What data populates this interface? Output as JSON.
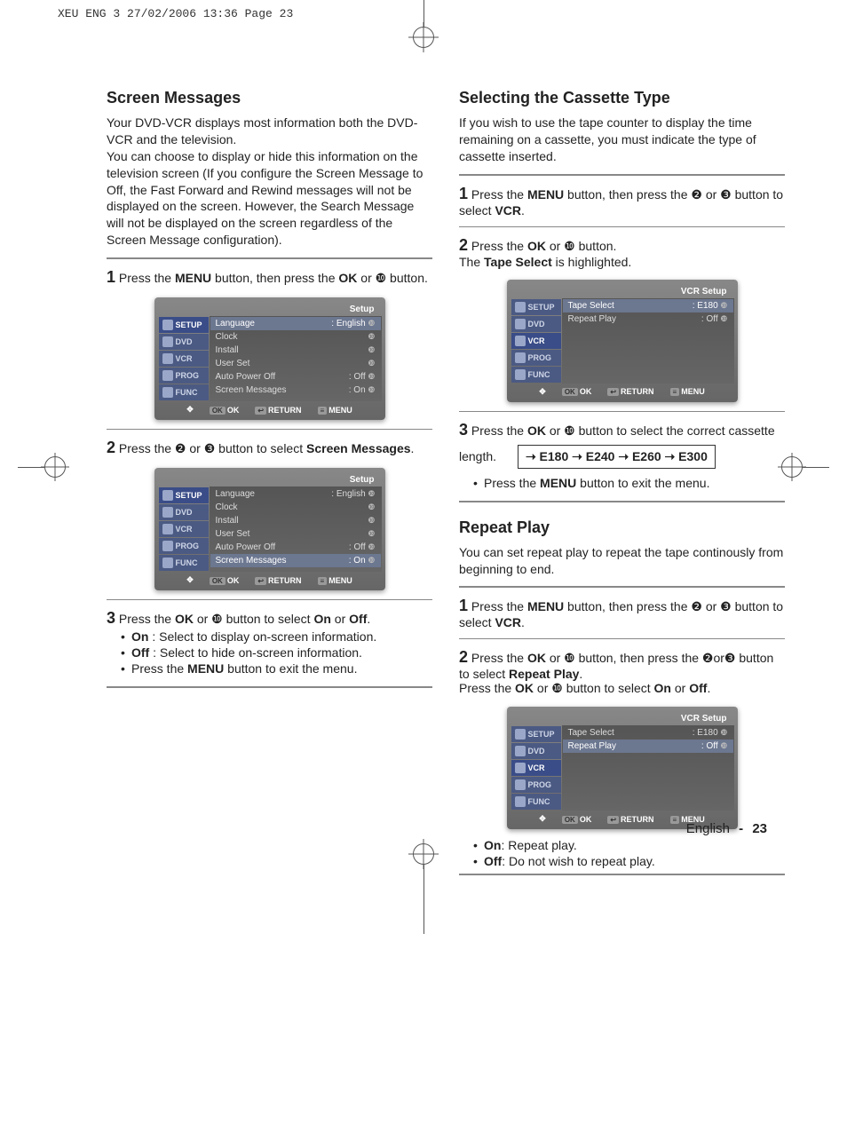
{
  "print_header": "XEU ENG 3   27/02/2006  13:36  Page 23",
  "left": {
    "title": "Screen Messages",
    "intro": "Your DVD-VCR displays most information both the DVD-VCR and the television.\nYou can choose to display or hide this information on the television screen (If you configure the Screen Message to Off, the Fast Forward and Rewind messages will not be displayed on the screen. However, the Search Message will not be displayed on the screen regardless of the Screen Message configuration).",
    "step1": {
      "num": "1",
      "text_a": "Press the ",
      "bold_a": "MENU",
      "text_b": " button, then press the ",
      "bold_b": "OK",
      "text_c": " or ❿ button."
    },
    "step2": {
      "num": "2",
      "text_a": "Press the ❷ or ❸ button to select ",
      "bold_a": "Screen Messages",
      "text_b": "."
    },
    "step3": {
      "num": "3",
      "text_a": "Press the ",
      "bold_a": "OK",
      "text_b": " or ❿ button to select ",
      "bold_b": "On",
      "text_c": " or ",
      "bold_c": "Off",
      "text_d": "."
    },
    "bullets": [
      {
        "b": "On",
        "t": " : Select to display on-screen information."
      },
      {
        "b": "Off",
        "t": " : Select to hide on-screen information."
      },
      {
        "b": "",
        "t": "Press the ",
        "b2": "MENU",
        "t2": " button to exit the menu."
      }
    ]
  },
  "right": {
    "sec1": {
      "title": "Selecting the Cassette Type",
      "intro": "If you wish to use the tape counter to display the time remaining on a cassette, you must indicate the type of cassette inserted.",
      "step1": {
        "num": "1",
        "text_a": "Press the ",
        "bold_a": "MENU",
        "text_b": " button, then press the ❷ or ❸ button to select ",
        "bold_b": "VCR",
        "text_c": "."
      },
      "step2": {
        "num": "2",
        "text_a": "Press the ",
        "bold_a": "OK",
        "text_b": " or ❿ button.",
        "line2_a": "The ",
        "line2_b": "Tape Select",
        "line2_c": " is highlighted."
      },
      "step3": {
        "num": "3",
        "text_a": "Press the ",
        "bold_a": "OK",
        "text_b": " or ❿ button to select the correct cassette length."
      },
      "chain": "➝ E180 ➝ E240 ➝ E260 ➝ E300",
      "bullet": {
        "t": "Press the ",
        "b": "MENU",
        "t2": " button to exit the menu."
      }
    },
    "sec2": {
      "title": "Repeat Play",
      "intro": "You can set repeat play to repeat the tape continously from beginning to end.",
      "step1": {
        "num": "1",
        "text_a": "Press the ",
        "bold_a": "MENU",
        "text_b": " button, then press the ❷ or ❸ button to select ",
        "bold_b": "VCR",
        "text_c": "."
      },
      "step2": {
        "num": "2",
        "text_a": "Press the ",
        "bold_a": "OK",
        "text_b": " or ❿ button, then press the ❷or❸ button to select ",
        "bold_b": "Repeat Play",
        "text_c": ".",
        "line2_a": "Press the ",
        "line2_b": "OK",
        "line2_c": " or ❿ button to select ",
        "line2_d": "On",
        "line2_e": " or ",
        "line2_f": "Off",
        "line2_g": "."
      },
      "bullets": [
        {
          "b": "On",
          "t": ": Repeat play."
        },
        {
          "b": "Off",
          "t": ": Do not wish to repeat play."
        }
      ]
    }
  },
  "osd_setup": {
    "title": "Setup",
    "tabs": [
      "SETUP",
      "DVD",
      "VCR",
      "PROG",
      "FUNC"
    ],
    "rows": [
      {
        "label": "Language",
        "value": ": English"
      },
      {
        "label": "Clock",
        "value": ""
      },
      {
        "label": "Install",
        "value": ""
      },
      {
        "label": "User Set",
        "value": ""
      },
      {
        "label": "Auto Power Off",
        "value": ": Off"
      },
      {
        "label": "Screen Messages",
        "value": ": On"
      }
    ],
    "footer": {
      "ok": "OK",
      "ret": "RETURN",
      "menu": "MENU"
    }
  },
  "osd_setup_hl": {
    "title": "Setup",
    "tabs": [
      "SETUP",
      "DVD",
      "VCR",
      "PROG",
      "FUNC"
    ],
    "rows": [
      {
        "label": "Language",
        "value": ": English"
      },
      {
        "label": "Clock",
        "value": ""
      },
      {
        "label": "Install",
        "value": ""
      },
      {
        "label": "User Set",
        "value": ""
      },
      {
        "label": "Auto Power Off",
        "value": ": Off"
      },
      {
        "label": "Screen Messages",
        "value": ": On",
        "hl": true
      }
    ],
    "footer": {
      "ok": "OK",
      "ret": "RETURN",
      "menu": "MENU"
    }
  },
  "osd_vcr1": {
    "title": "VCR Setup",
    "tabs": [
      "SETUP",
      "DVD",
      "VCR",
      "PROG",
      "FUNC"
    ],
    "rows": [
      {
        "label": "Tape Select",
        "value": ": E180",
        "hl": true
      },
      {
        "label": "Repeat Play",
        "value": ": Off"
      }
    ],
    "footer": {
      "ok": "OK",
      "ret": "RETURN",
      "menu": "MENU"
    }
  },
  "osd_vcr2": {
    "title": "VCR Setup",
    "tabs": [
      "SETUP",
      "DVD",
      "VCR",
      "PROG",
      "FUNC"
    ],
    "rows": [
      {
        "label": "Tape Select",
        "value": ": E180"
      },
      {
        "label": "Repeat Play",
        "value": ": Off",
        "hl": true
      }
    ],
    "footer": {
      "ok": "OK",
      "ret": "RETURN",
      "menu": "MENU"
    }
  },
  "footer": {
    "lang": "English",
    "sep": "-",
    "page": "23"
  }
}
